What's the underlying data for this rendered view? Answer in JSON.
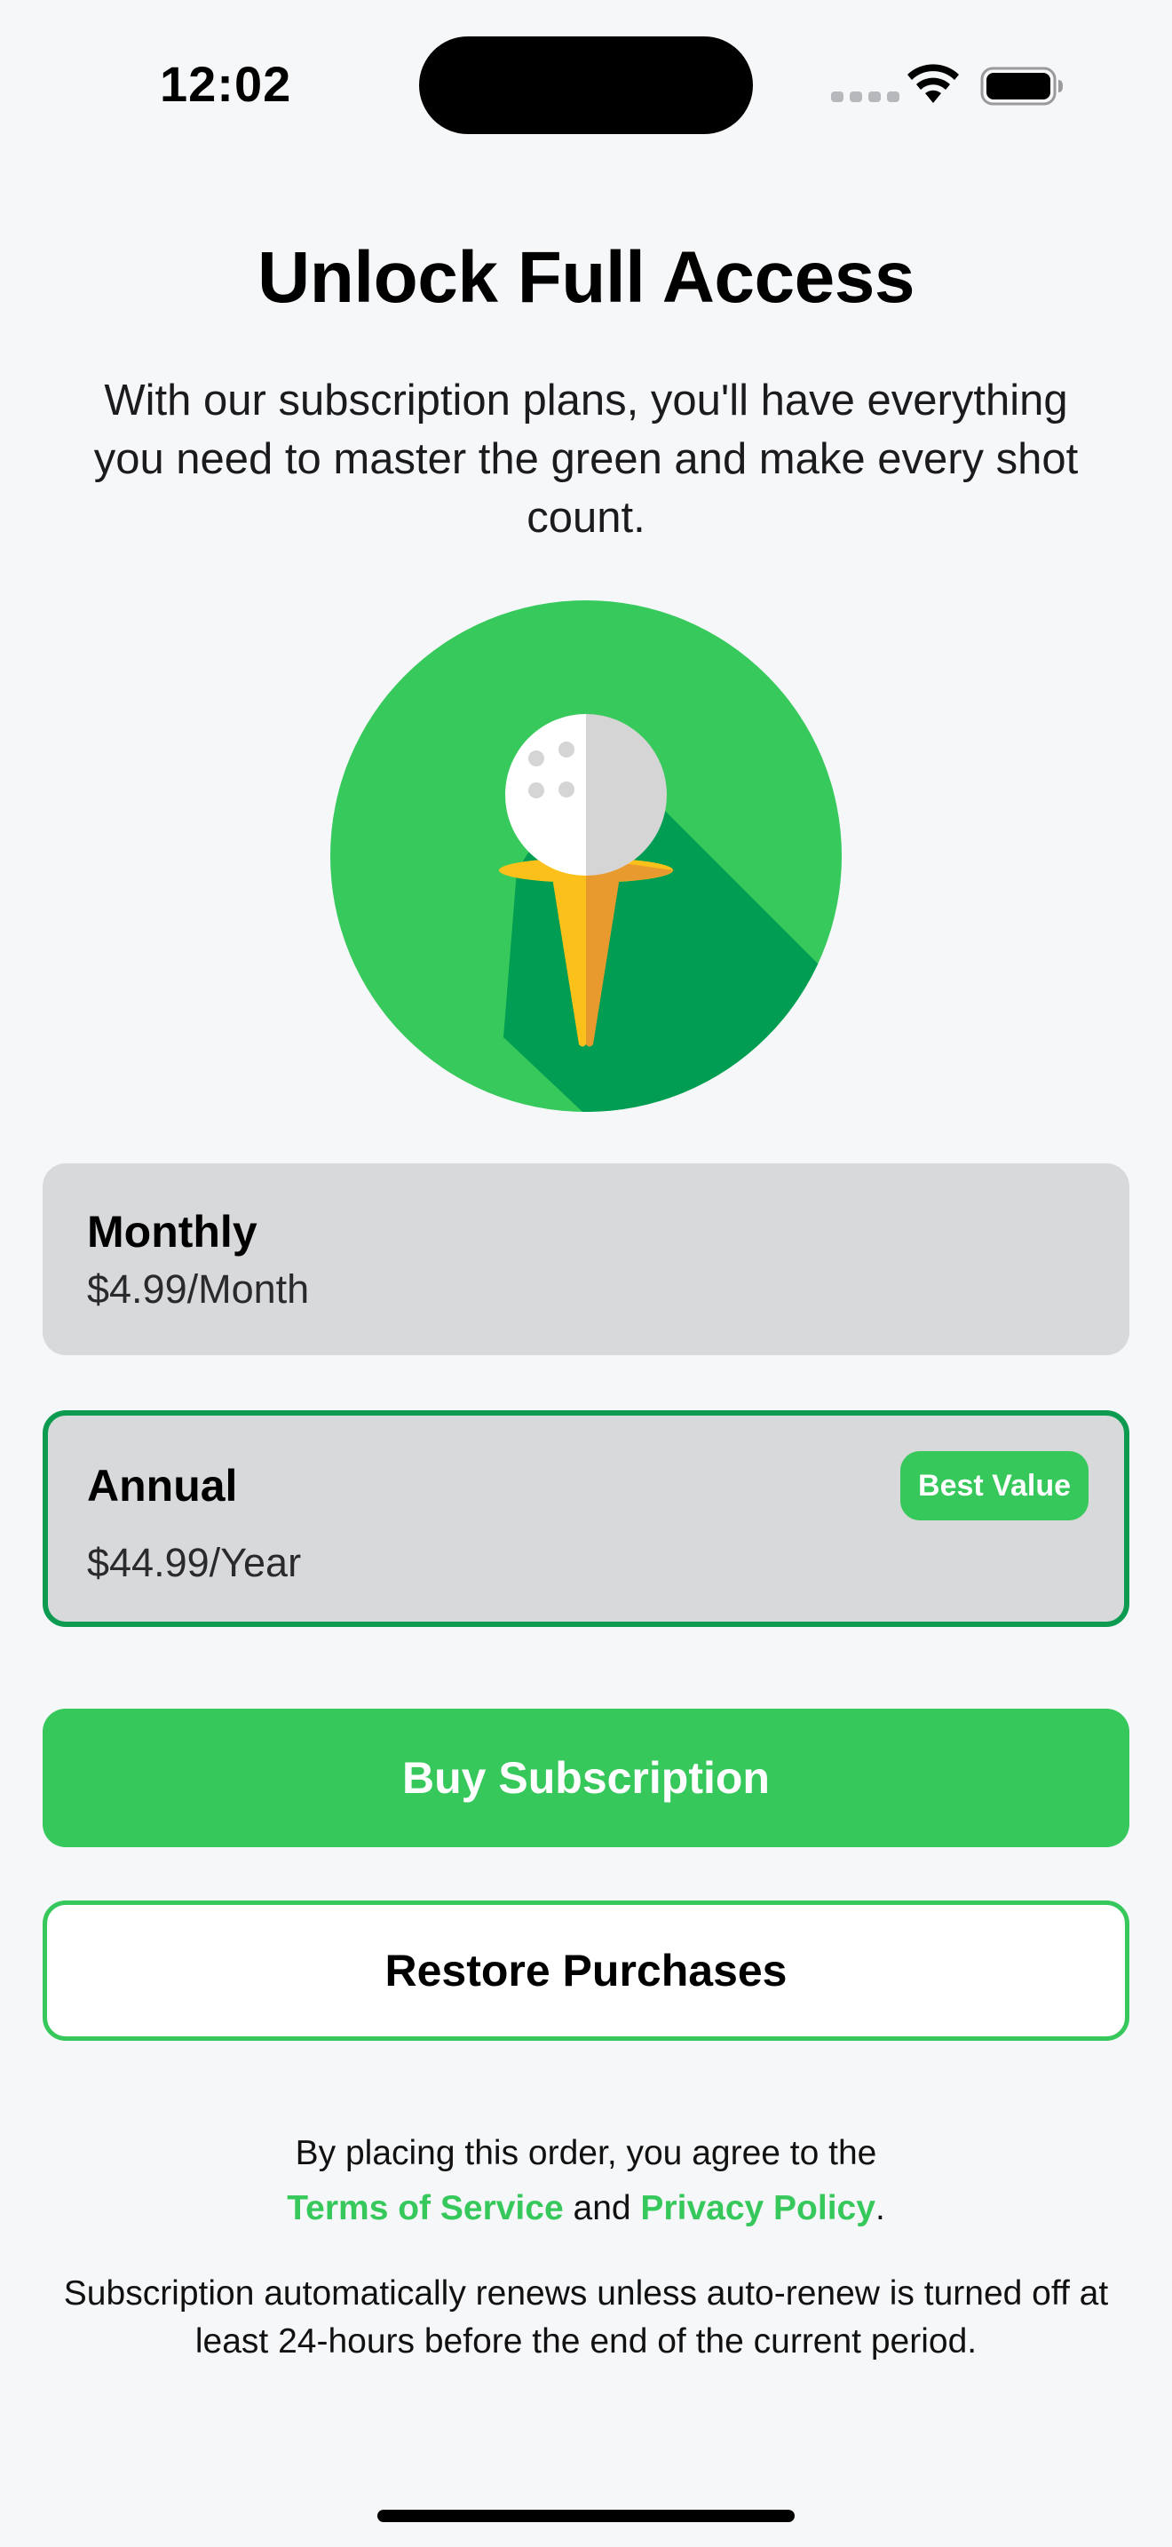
{
  "status_bar": {
    "time": "12:02"
  },
  "header": {
    "title": "Unlock Full Access",
    "subtitle": "With our subscription plans, you'll have everything you need to master the green and make every shot count."
  },
  "hero": {
    "icon": "golf-ball-on-tee-icon",
    "colors": {
      "circle": "#37c95b",
      "shadow": "#009d53",
      "ball": "#ffffff",
      "ball_shade": "#d5d5d5",
      "tee": "#fbc01a",
      "tee_shade": "#e89a2f"
    }
  },
  "plans": [
    {
      "name": "Monthly",
      "price": "$4.99/Month",
      "selected": false
    },
    {
      "name": "Annual",
      "price": "$44.99/Year",
      "badge": "Best Value",
      "selected": true
    }
  ],
  "actions": {
    "buy_label": "Buy Subscription",
    "restore_label": "Restore Purchases"
  },
  "legal": {
    "prefix": "By placing this order, you agree to the",
    "terms_link": "Terms of Service",
    "conjunction": "and",
    "privacy_link": "Privacy Policy",
    "suffix": ".",
    "renewal_notice": "Subscription automatically renews unless auto-renew is turned off at least 24-hours before the end of the current period."
  },
  "colors": {
    "accent": "#36c85b",
    "selected_border": "#0c9b50",
    "card_background": "#d8d9db",
    "page_background": "#f6f7f9"
  }
}
